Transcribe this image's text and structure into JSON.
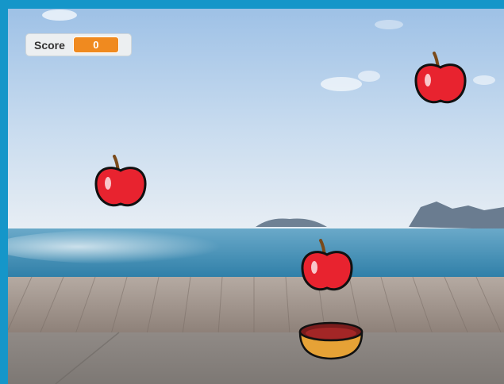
{
  "game": {
    "score_label": "Score",
    "score_value": "0"
  },
  "sprites": [
    {
      "name": "apple",
      "icon": "apple-icon"
    },
    {
      "name": "apple",
      "icon": "apple-icon"
    },
    {
      "name": "apple",
      "icon": "apple-icon"
    },
    {
      "name": "bowl",
      "icon": "bowl-icon"
    }
  ],
  "colors": {
    "frame": "#1596c9",
    "sky": "#a8c9e8",
    "sea": "#3d8fb5",
    "boardwalk": "#9b8e85",
    "pavement": "#8a8580",
    "apple": "#e8232f",
    "bowl": "#e6a236",
    "monitor_value": "#f08a1f"
  }
}
